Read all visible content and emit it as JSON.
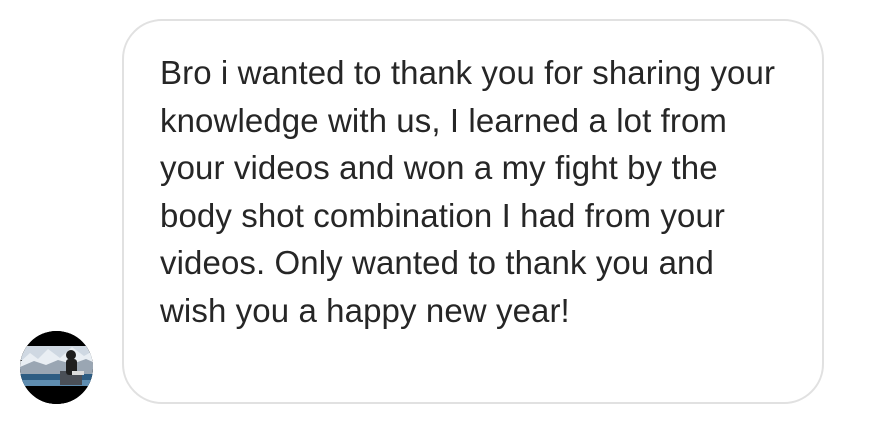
{
  "conversation": {
    "message": {
      "text": "Bro i wanted to thank you for sharing your knowledge with us, I learned a lot from your videos and won a my fight by the body shot combination I had from your videos. Only wanted to thank you and wish you a happy new year!"
    },
    "sender": {
      "avatar_icon": "profile-photo"
    }
  },
  "colors": {
    "bubble_border": "#e1e1e1",
    "text": "#262626",
    "background": "#ffffff"
  }
}
